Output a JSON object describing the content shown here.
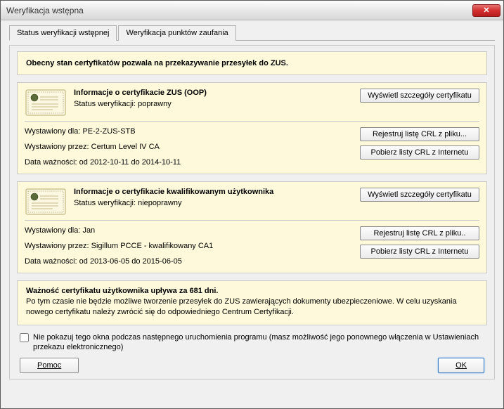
{
  "window": {
    "title": "Weryfikacja wstępna"
  },
  "tabs": {
    "tab1": "Status weryfikacji wstępnej",
    "tab2": "Weryfikacja punktów zaufania"
  },
  "summary": {
    "text": "Obecny stan certyfikatów pozwala na przekazywanie przesyłek do ZUS."
  },
  "cert1": {
    "title": "Informacje o certyfikacie ZUS (OOP)",
    "status_label": "Status weryfikacji:",
    "status_value": "poprawny",
    "issued_to_label": "Wystawiony dla:",
    "issued_to_value": "PE-2-ZUS-STB",
    "issued_by_label": "Wystawiony przez:",
    "issued_by_value": "Certum Level IV CA",
    "validity_label": "Data ważności:",
    "validity_value": "od 2012-10-11 do 2014-10-11",
    "btn_details": "Wyświetl szczegóły certyfikatu",
    "btn_register": "Rejestruj listę CRL z pliku...",
    "btn_download": "Pobierz listy CRL z Internetu"
  },
  "cert2": {
    "title": "Informacje o certyfikacie kwalifikowanym użytkownika",
    "status_label": "Status weryfikacji:",
    "status_value": "niepoprawny",
    "issued_to_label": "Wystawiony dla:",
    "issued_to_value": "Jan",
    "issued_by_label": "Wystawiony przez:",
    "issued_by_value": "Sigillum PCCE - kwalifikowany CA1",
    "validity_label": "Data ważności:",
    "validity_value": "od 2013-06-05 do 2015-06-05",
    "btn_details": "Wyświetl szczegóły certyfikatu",
    "btn_register": "Rejestruj listę CRL z pliku..",
    "btn_download": "Pobierz listy CRL z Internetu"
  },
  "expiry": {
    "title": "Ważność certyfikatu użytkownika upływa za 681 dni.",
    "text": "Po tym czasie nie będzie możliwe tworzenie przesyłek do ZUS zawierających dokumenty ubezpieczeniowe. W celu uzyskania nowego certyfikatu należy zwrócić się do odpowiedniego Centrum Certyfikacji."
  },
  "checkbox": {
    "label": "Nie pokazuj tego okna podczas następnego uruchomienia programu (masz możliwość jego ponownego włączenia w Ustawieniach przekazu elektronicznego)"
  },
  "footer": {
    "help": "Pomoc",
    "ok": "OK"
  }
}
